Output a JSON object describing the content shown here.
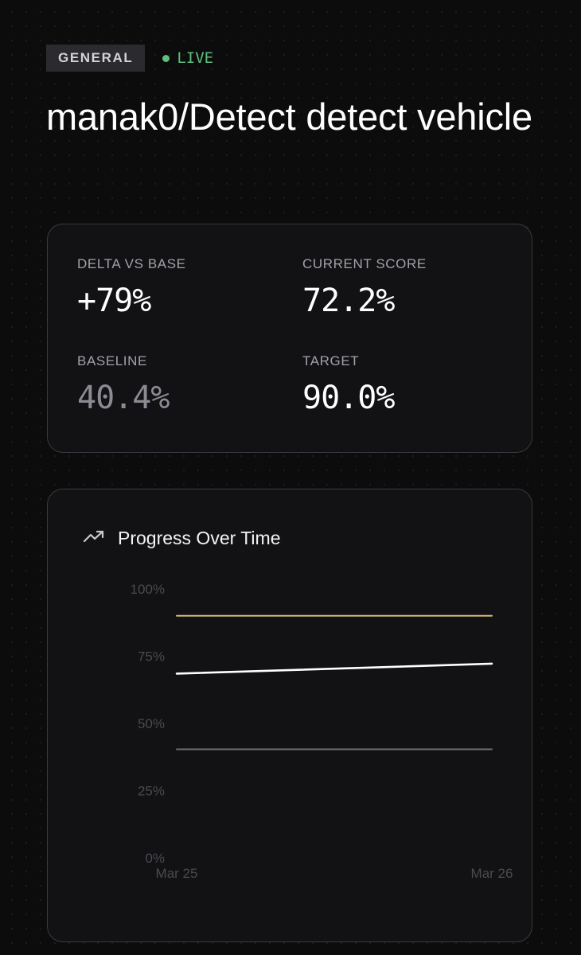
{
  "header": {
    "category": "GENERAL",
    "status": "LIVE",
    "title": "manak0/Detect detect vehicle"
  },
  "stats": {
    "delta_label": "DELTA VS BASE",
    "delta_value": "+79%",
    "current_label": "CURRENT SCORE",
    "current_value": "72.2%",
    "baseline_label": "BASELINE",
    "baseline_value": "40.4%",
    "target_label": "TARGET",
    "target_value": "90.0%"
  },
  "chart": {
    "title": "Progress Over Time",
    "icon": "trending-up-icon"
  },
  "colors": {
    "live": "#5fbf7f",
    "target_line": "#d9b873",
    "score_line": "#ffffff",
    "baseline_line": "#6e6e76"
  },
  "chart_data": {
    "type": "line",
    "title": "Progress Over Time",
    "x": [
      "Mar 25",
      "Mar 26"
    ],
    "x_tick_labels": [
      "Mar 25",
      "Mar 26"
    ],
    "y_tick_labels": [
      "100%",
      "75%",
      "50%",
      "25%",
      "0%"
    ],
    "y_ticks": [
      100,
      75,
      50,
      25,
      0
    ],
    "ylim": [
      0,
      100
    ],
    "grid": false,
    "legend": "none",
    "series": [
      {
        "key": "target",
        "values": [
          90.0,
          90.0
        ],
        "color": "#d9b873"
      },
      {
        "key": "current",
        "values": [
          68.5,
          72.2
        ],
        "color": "#ffffff"
      },
      {
        "key": "baseline",
        "values": [
          40.4,
          40.4
        ],
        "color": "#6e6e76"
      }
    ]
  }
}
